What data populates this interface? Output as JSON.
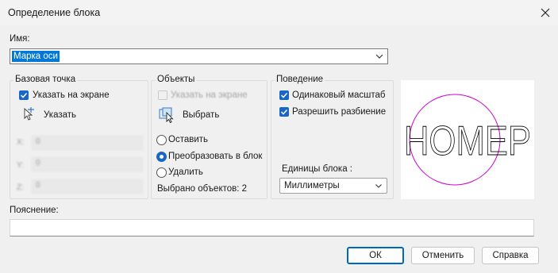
{
  "window": {
    "title": "Определение блока",
    "close_icon": "close-icon"
  },
  "name_section": {
    "label": "Имя:",
    "value": "Марка оси"
  },
  "base_point": {
    "title": "Базовая точка",
    "specify_on_screen": {
      "label": "Указать на экране",
      "checked": true
    },
    "pick_button": "Указать",
    "coords": [
      {
        "axis": "X:",
        "value": "0"
      },
      {
        "axis": "Y:",
        "value": "0"
      },
      {
        "axis": "Z:",
        "value": "0"
      }
    ]
  },
  "objects": {
    "title": "Объекты",
    "specify_on_screen": {
      "label": "Указать на экране",
      "checked": false,
      "enabled": false
    },
    "select_button": "Выбрать",
    "options": [
      {
        "label": "Оставить",
        "selected": false
      },
      {
        "label": "Преобразовать в блок",
        "selected": true
      },
      {
        "label": "Удалить",
        "selected": false
      }
    ],
    "selected_count": "Выбрано объектов: 2"
  },
  "behavior": {
    "title": "Поведение",
    "uniform_scale": {
      "label": "Одинаковый масштаб",
      "checked": true
    },
    "allow_explode": {
      "label": "Разрешить разбиение",
      "checked": true
    },
    "units_label": "Единицы блока :",
    "units_value": "Миллиметры"
  },
  "preview": {
    "text": "НОМЕР",
    "circle_color": "#d000d0",
    "text_color": "#000000"
  },
  "description": {
    "label": "Пояснение:",
    "value": ""
  },
  "buttons": {
    "ok": "ОК",
    "cancel": "Отменить",
    "help": "Справка"
  },
  "colors": {
    "accent": "#0067c0",
    "selection": "#0078d7",
    "checkbox": "#1a66c4"
  }
}
